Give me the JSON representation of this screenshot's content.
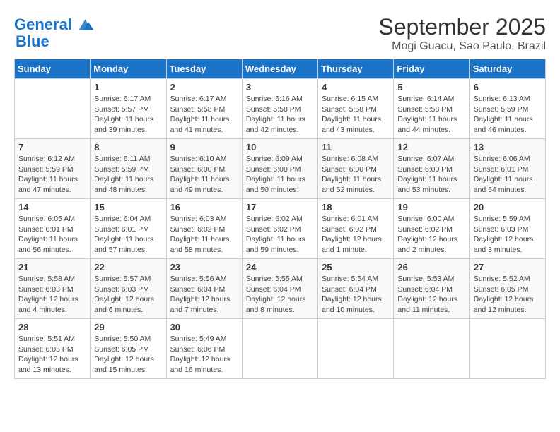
{
  "header": {
    "logo_line1": "General",
    "logo_line2": "Blue",
    "month": "September 2025",
    "location": "Mogi Guacu, Sao Paulo, Brazil"
  },
  "days_of_week": [
    "Sunday",
    "Monday",
    "Tuesday",
    "Wednesday",
    "Thursday",
    "Friday",
    "Saturday"
  ],
  "weeks": [
    [
      {
        "num": "",
        "info": ""
      },
      {
        "num": "1",
        "info": "Sunrise: 6:17 AM\nSunset: 5:57 PM\nDaylight: 11 hours\nand 39 minutes."
      },
      {
        "num": "2",
        "info": "Sunrise: 6:17 AM\nSunset: 5:58 PM\nDaylight: 11 hours\nand 41 minutes."
      },
      {
        "num": "3",
        "info": "Sunrise: 6:16 AM\nSunset: 5:58 PM\nDaylight: 11 hours\nand 42 minutes."
      },
      {
        "num": "4",
        "info": "Sunrise: 6:15 AM\nSunset: 5:58 PM\nDaylight: 11 hours\nand 43 minutes."
      },
      {
        "num": "5",
        "info": "Sunrise: 6:14 AM\nSunset: 5:58 PM\nDaylight: 11 hours\nand 44 minutes."
      },
      {
        "num": "6",
        "info": "Sunrise: 6:13 AM\nSunset: 5:59 PM\nDaylight: 11 hours\nand 46 minutes."
      }
    ],
    [
      {
        "num": "7",
        "info": "Sunrise: 6:12 AM\nSunset: 5:59 PM\nDaylight: 11 hours\nand 47 minutes."
      },
      {
        "num": "8",
        "info": "Sunrise: 6:11 AM\nSunset: 5:59 PM\nDaylight: 11 hours\nand 48 minutes."
      },
      {
        "num": "9",
        "info": "Sunrise: 6:10 AM\nSunset: 6:00 PM\nDaylight: 11 hours\nand 49 minutes."
      },
      {
        "num": "10",
        "info": "Sunrise: 6:09 AM\nSunset: 6:00 PM\nDaylight: 11 hours\nand 50 minutes."
      },
      {
        "num": "11",
        "info": "Sunrise: 6:08 AM\nSunset: 6:00 PM\nDaylight: 11 hours\nand 52 minutes."
      },
      {
        "num": "12",
        "info": "Sunrise: 6:07 AM\nSunset: 6:00 PM\nDaylight: 11 hours\nand 53 minutes."
      },
      {
        "num": "13",
        "info": "Sunrise: 6:06 AM\nSunset: 6:01 PM\nDaylight: 11 hours\nand 54 minutes."
      }
    ],
    [
      {
        "num": "14",
        "info": "Sunrise: 6:05 AM\nSunset: 6:01 PM\nDaylight: 11 hours\nand 56 minutes."
      },
      {
        "num": "15",
        "info": "Sunrise: 6:04 AM\nSunset: 6:01 PM\nDaylight: 11 hours\nand 57 minutes."
      },
      {
        "num": "16",
        "info": "Sunrise: 6:03 AM\nSunset: 6:02 PM\nDaylight: 11 hours\nand 58 minutes."
      },
      {
        "num": "17",
        "info": "Sunrise: 6:02 AM\nSunset: 6:02 PM\nDaylight: 11 hours\nand 59 minutes."
      },
      {
        "num": "18",
        "info": "Sunrise: 6:01 AM\nSunset: 6:02 PM\nDaylight: 12 hours\nand 1 minute."
      },
      {
        "num": "19",
        "info": "Sunrise: 6:00 AM\nSunset: 6:02 PM\nDaylight: 12 hours\nand 2 minutes."
      },
      {
        "num": "20",
        "info": "Sunrise: 5:59 AM\nSunset: 6:03 PM\nDaylight: 12 hours\nand 3 minutes."
      }
    ],
    [
      {
        "num": "21",
        "info": "Sunrise: 5:58 AM\nSunset: 6:03 PM\nDaylight: 12 hours\nand 4 minutes."
      },
      {
        "num": "22",
        "info": "Sunrise: 5:57 AM\nSunset: 6:03 PM\nDaylight: 12 hours\nand 6 minutes."
      },
      {
        "num": "23",
        "info": "Sunrise: 5:56 AM\nSunset: 6:04 PM\nDaylight: 12 hours\nand 7 minutes."
      },
      {
        "num": "24",
        "info": "Sunrise: 5:55 AM\nSunset: 6:04 PM\nDaylight: 12 hours\nand 8 minutes."
      },
      {
        "num": "25",
        "info": "Sunrise: 5:54 AM\nSunset: 6:04 PM\nDaylight: 12 hours\nand 10 minutes."
      },
      {
        "num": "26",
        "info": "Sunrise: 5:53 AM\nSunset: 6:04 PM\nDaylight: 12 hours\nand 11 minutes."
      },
      {
        "num": "27",
        "info": "Sunrise: 5:52 AM\nSunset: 6:05 PM\nDaylight: 12 hours\nand 12 minutes."
      }
    ],
    [
      {
        "num": "28",
        "info": "Sunrise: 5:51 AM\nSunset: 6:05 PM\nDaylight: 12 hours\nand 13 minutes."
      },
      {
        "num": "29",
        "info": "Sunrise: 5:50 AM\nSunset: 6:05 PM\nDaylight: 12 hours\nand 15 minutes."
      },
      {
        "num": "30",
        "info": "Sunrise: 5:49 AM\nSunset: 6:06 PM\nDaylight: 12 hours\nand 16 minutes."
      },
      {
        "num": "",
        "info": ""
      },
      {
        "num": "",
        "info": ""
      },
      {
        "num": "",
        "info": ""
      },
      {
        "num": "",
        "info": ""
      }
    ]
  ]
}
